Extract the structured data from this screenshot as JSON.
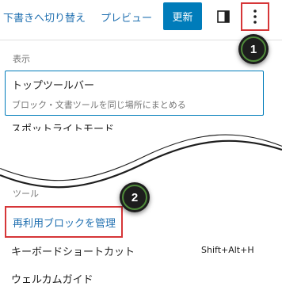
{
  "toolbar": {
    "switch_to_draft": "下書きへ切り替え",
    "preview": "プレビュー",
    "update": "更新",
    "sidebar_icon": "sidebar-toggle-icon",
    "more_icon": "vertical-ellipsis-icon"
  },
  "menu": {
    "view_section": "表示",
    "top_toolbar_label": "トップツールバー",
    "top_toolbar_desc": "ブロック・文書ツールを同じ場所にまとめる",
    "spotlight_label": "スポットライトモード",
    "tools_section": "ツール",
    "manage_reusable_label": "再利用ブロックを管理",
    "keyboard_shortcuts_label": "キーボードショートカット",
    "keyboard_shortcuts_shortcut": "Shift+Alt+H",
    "welcome_guide_label": "ウェルカムガイド"
  },
  "callouts": {
    "one": "1",
    "two": "2"
  },
  "colors": {
    "accent": "#007cba",
    "link": "#2271b1",
    "highlight": "#d63638",
    "callout_bg": "#1d1d1d",
    "callout_ring": "#4f8a3a"
  }
}
